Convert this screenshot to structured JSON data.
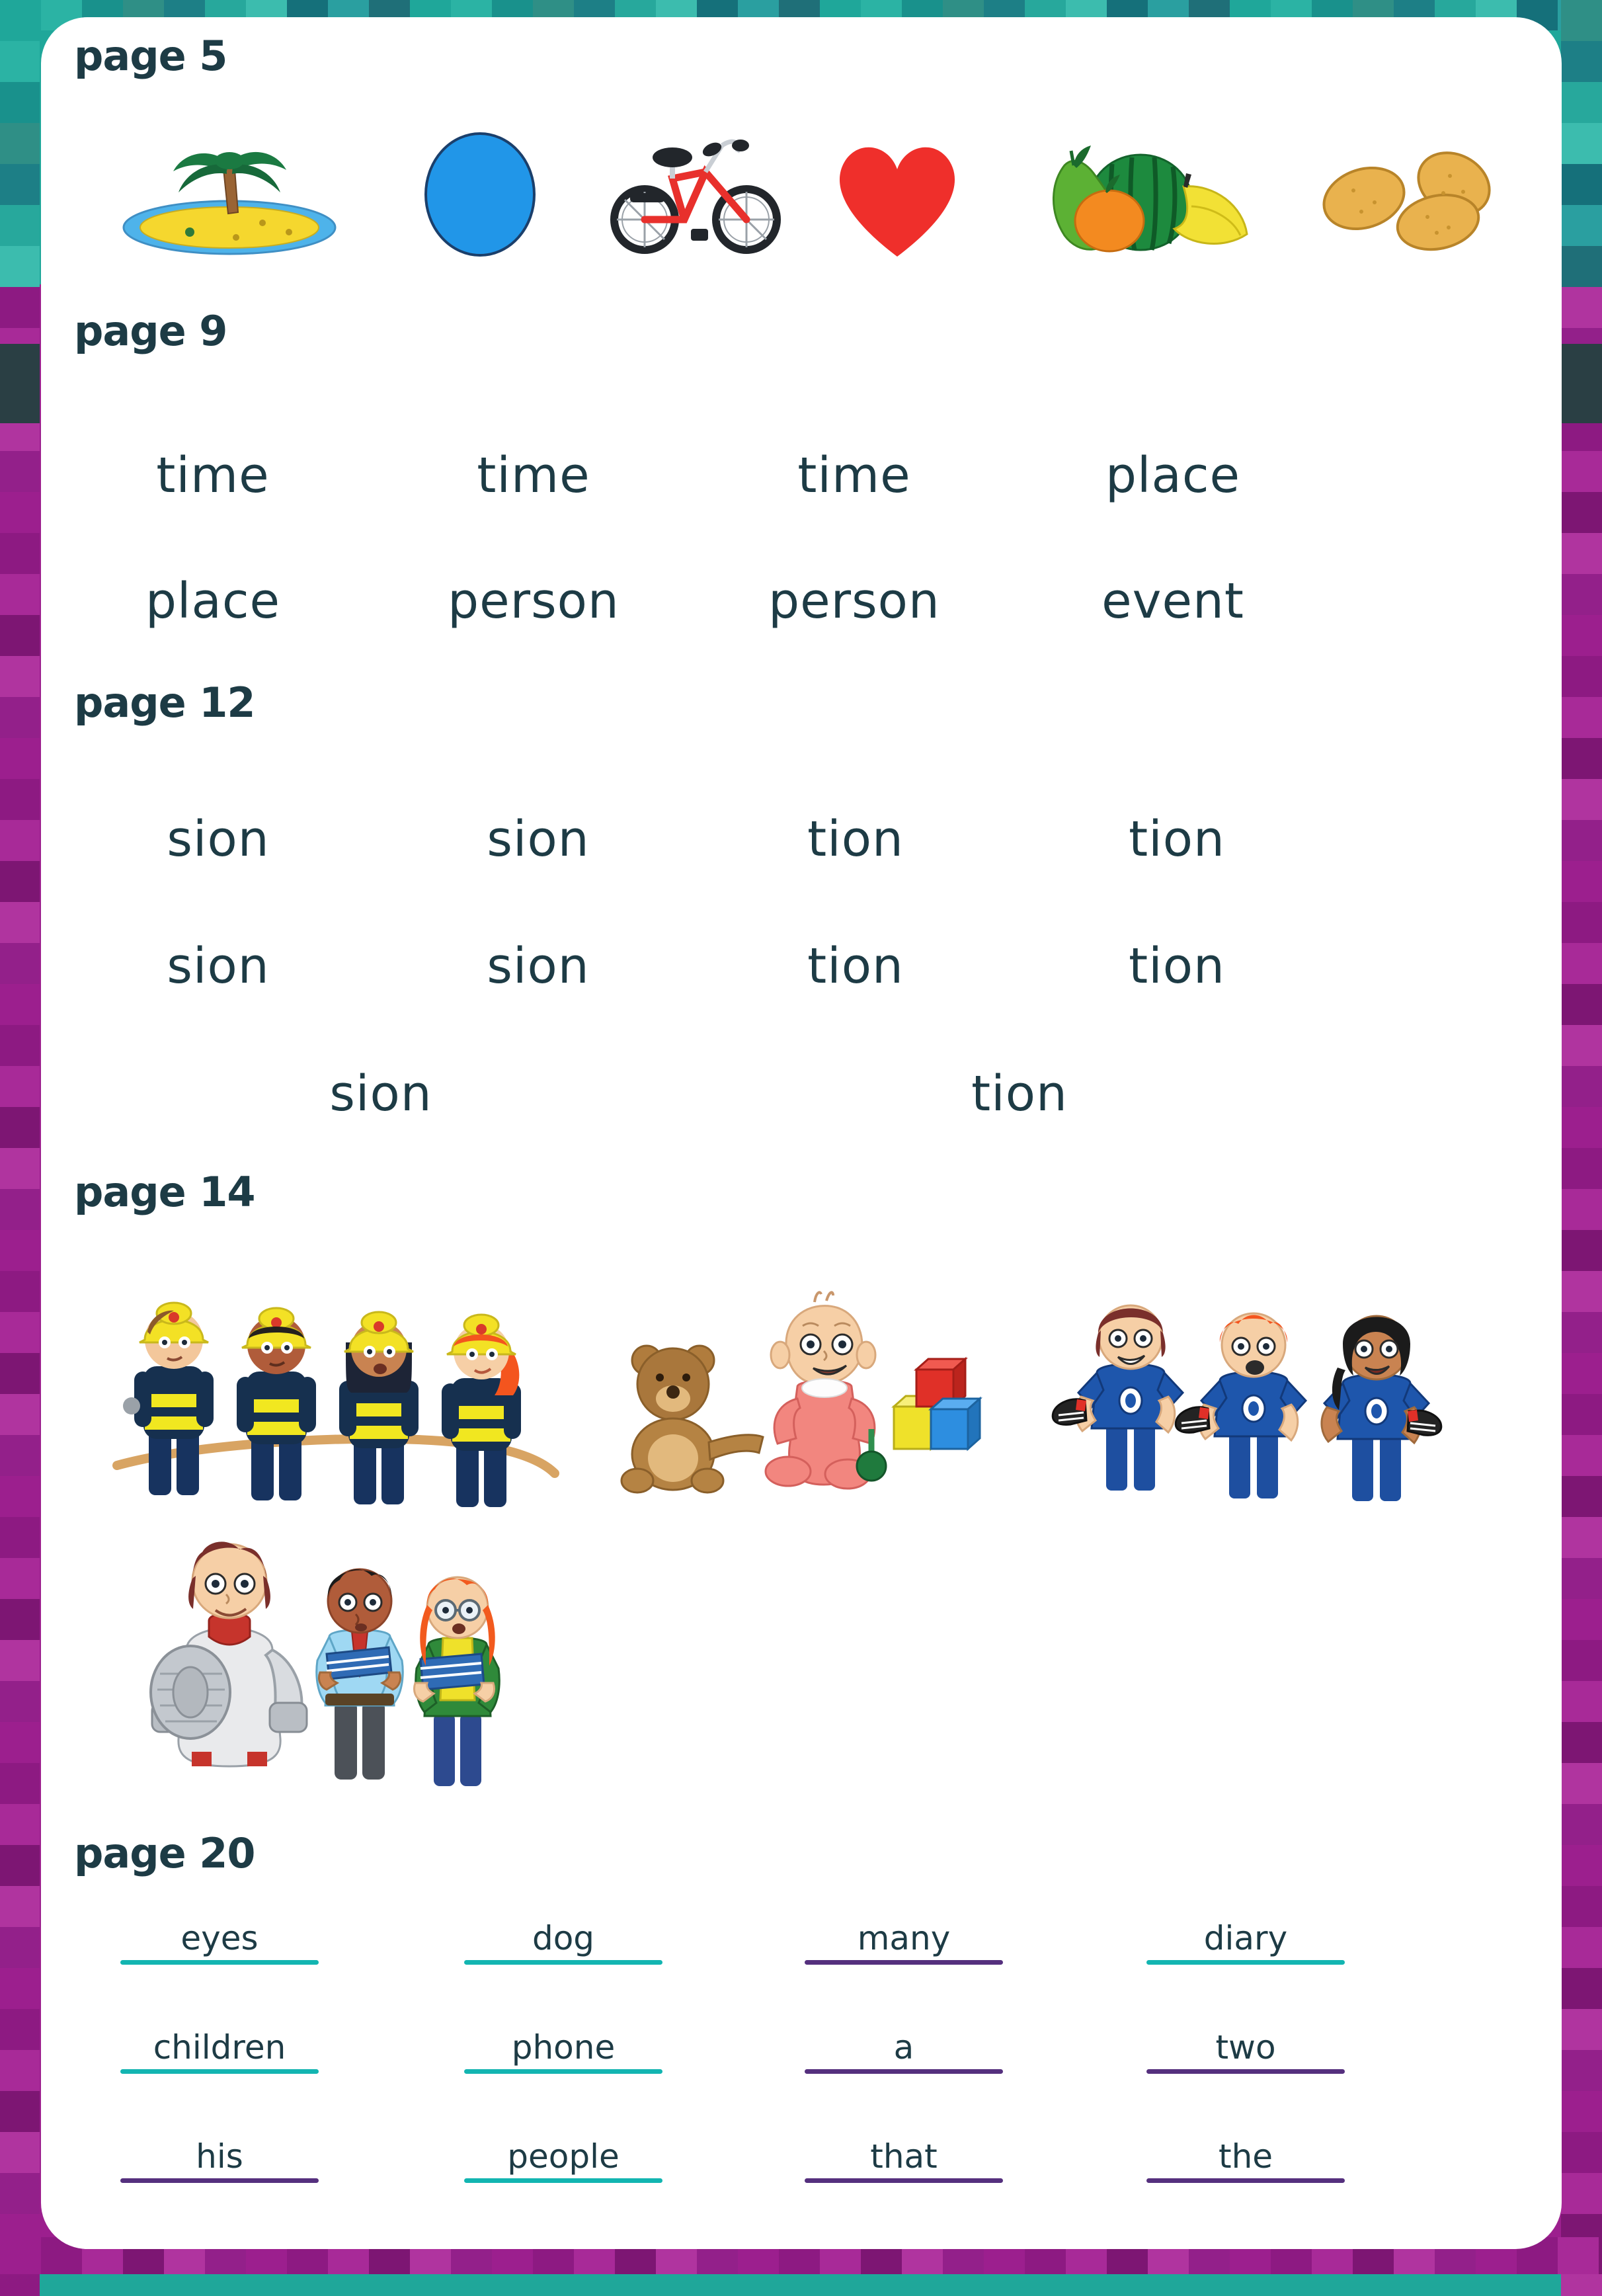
{
  "theme": {
    "heading_color": "#1d3b45",
    "word_color": "#1d3b45",
    "card_background": "#ffffff",
    "border_teal": "#1fa79a",
    "border_magenta": "#9c1f8e",
    "underline_teal": "#13b5b1",
    "underline_purple": "#55307e"
  },
  "sections": [
    {
      "id": "page-5",
      "heading": "page 5",
      "kind": "pictures",
      "pictures": [
        {
          "name": "island-icon",
          "label": "island"
        },
        {
          "name": "ball-icon",
          "label": "ball"
        },
        {
          "name": "bicycle-icon",
          "label": "bicycle"
        },
        {
          "name": "heart-icon",
          "label": "heart"
        },
        {
          "name": "fruit-icon",
          "label": "fruit"
        },
        {
          "name": "potatoes-icon",
          "label": "potatoes"
        }
      ]
    },
    {
      "id": "page-9",
      "heading": "page 9",
      "kind": "words",
      "rows": [
        [
          "time",
          "time",
          "time",
          "place"
        ],
        [
          "place",
          "person",
          "person",
          "event"
        ]
      ]
    },
    {
      "id": "page-12",
      "heading": "page 12",
      "kind": "words",
      "rows": [
        [
          "sion",
          "sion",
          "tion",
          "tion"
        ],
        [
          "sion",
          "sion",
          "tion",
          "tion"
        ]
      ],
      "extra_row": [
        "sion",
        "tion"
      ]
    },
    {
      "id": "page-14",
      "heading": "page 14",
      "kind": "pictures",
      "groups": [
        {
          "name": "firefighters-icon",
          "label": "four firefighters holding a hose"
        },
        {
          "name": "baby-toys-icon",
          "label": "baby with teddy bear, rattle and building blocks"
        },
        {
          "name": "footballers-icon",
          "label": "three children in blue kit holding football boots"
        },
        {
          "name": "knight-pupils-icon",
          "label": "knight in armour, schoolboy and schoolgirl with books"
        }
      ]
    },
    {
      "id": "page-20",
      "heading": "page 20",
      "kind": "answers",
      "rows": [
        [
          {
            "word": "eyes",
            "rule": "teal"
          },
          {
            "word": "dog",
            "rule": "teal"
          },
          {
            "word": "many",
            "rule": "purple"
          },
          {
            "word": "diary",
            "rule": "teal"
          }
        ],
        [
          {
            "word": "children",
            "rule": "teal"
          },
          {
            "word": "phone",
            "rule": "teal"
          },
          {
            "word": "a",
            "rule": "purple"
          },
          {
            "word": "two",
            "rule": "purple"
          }
        ],
        [
          {
            "word": "his",
            "rule": "purple"
          },
          {
            "word": "people",
            "rule": "teal"
          },
          {
            "word": "that",
            "rule": "purple"
          },
          {
            "word": "the",
            "rule": "purple"
          }
        ]
      ]
    }
  ]
}
